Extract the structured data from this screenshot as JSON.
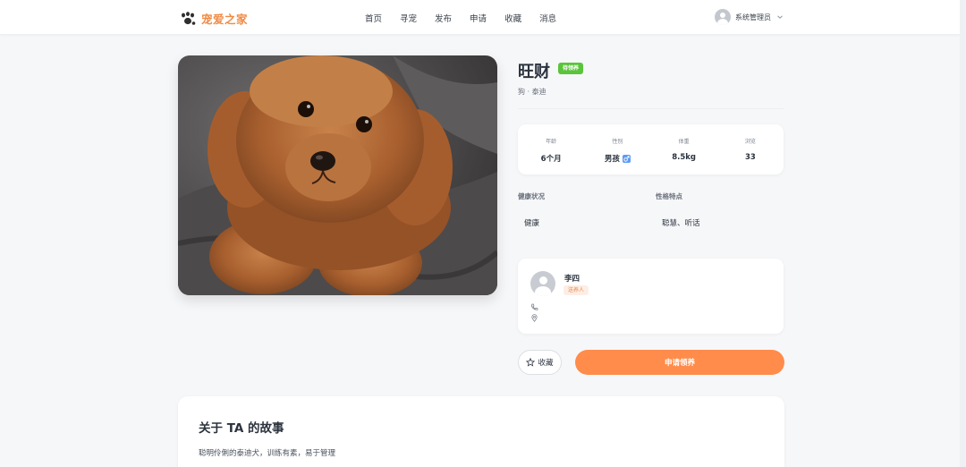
{
  "header": {
    "logo_text": "宠爱之家",
    "logo_icon": "paw-icon",
    "nav": [
      "首页",
      "寻宠",
      "发布",
      "申请",
      "收藏",
      "消息"
    ],
    "user_name": "系统管理员"
  },
  "pet": {
    "name": "旺财",
    "status_badge": "待领养",
    "breed": "狗 · 泰迪",
    "stats": [
      {
        "label": "年龄",
        "value": "6个月"
      },
      {
        "label": "性别",
        "value": "男孩"
      },
      {
        "label": "体重",
        "value": "8.5kg"
      },
      {
        "label": "浏览",
        "value": "33"
      }
    ],
    "health_label": "健康状况",
    "health_value": "健康",
    "personality_label": "性格特点",
    "personality_value": "聪慧、听话"
  },
  "owner": {
    "name": "李四",
    "role": "送养人"
  },
  "actions": {
    "favorite_label": "收藏",
    "apply_label": "申请领养"
  },
  "story": {
    "title": "关于 TA 的故事",
    "text": "聪明伶俐的泰迪犬，训练有素，易于管理"
  },
  "colors": {
    "brand": "#f08a45",
    "apply_button": "#ff8c4a",
    "status_green": "#5ac43a",
    "male_blue": "#5b9cf5"
  }
}
